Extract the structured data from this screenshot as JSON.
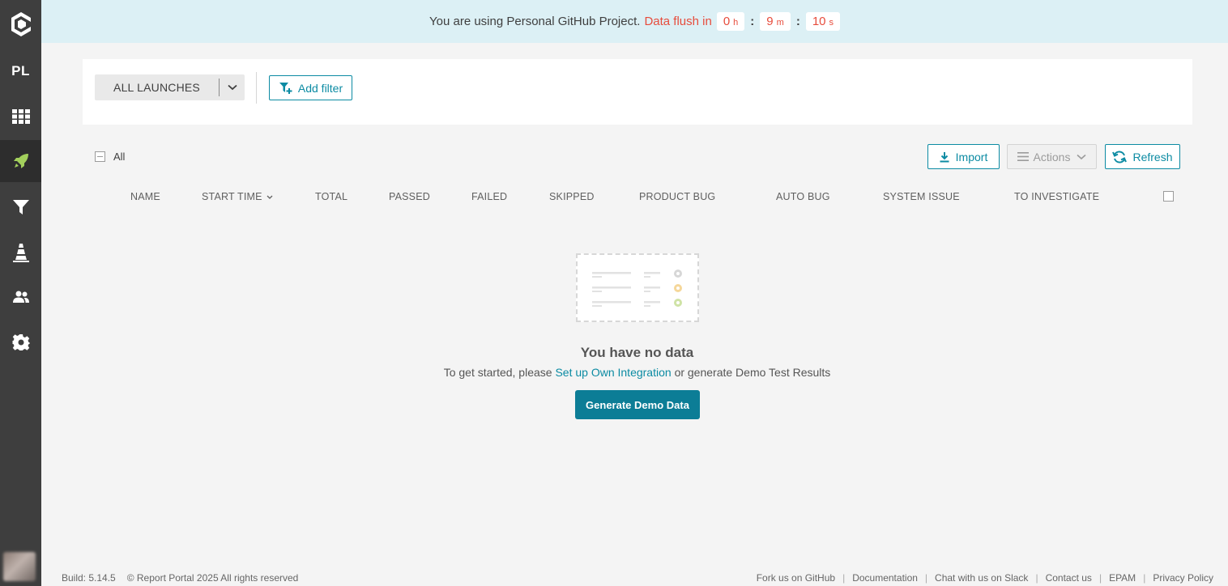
{
  "sidebar": {
    "project_initials": "PL"
  },
  "banner": {
    "message": "You are using Personal GitHub Project.",
    "flush_label": "Data flush in",
    "timer": {
      "hours": "0",
      "hours_unit": "h",
      "minutes": "9",
      "minutes_unit": "m",
      "seconds": "10",
      "seconds_unit": "s"
    }
  },
  "filters": {
    "launch_select_value": "ALL LAUNCHES",
    "add_filter_label": "Add filter"
  },
  "toolbar": {
    "select_all_label": "All",
    "import_label": "Import",
    "actions_label": "Actions",
    "refresh_label": "Refresh"
  },
  "table": {
    "columns": {
      "name": "NAME",
      "start_time": "START TIME",
      "total": "TOTAL",
      "passed": "PASSED",
      "failed": "FAILED",
      "skipped": "SKIPPED",
      "product_bug": "PRODUCT BUG",
      "auto_bug": "AUTO BUG",
      "system_issue": "SYSTEM ISSUE",
      "to_investigate": "TO INVESTIGATE"
    }
  },
  "empty_state": {
    "title": "You have no data",
    "text_before": "To get started, please",
    "link": "Set up Own Integration",
    "text_after": "or generate Demo Test Results",
    "button": "Generate Demo Data"
  },
  "footer": {
    "build": "Build: 5.14.5",
    "copyright": "© Report Portal 2025 All rights reserved",
    "links": [
      "Fork us on GitHub",
      "Documentation",
      "Chat with us on Slack",
      "Contact us",
      "EPAM",
      "Privacy Policy"
    ]
  },
  "colors": {
    "accent": "#0c8ba3",
    "sidebar_bg": "#3e3e3e",
    "banner_bg": "#dcf0f5",
    "timer_text": "#e74c3c",
    "active_icon": "#a2cf5c"
  }
}
